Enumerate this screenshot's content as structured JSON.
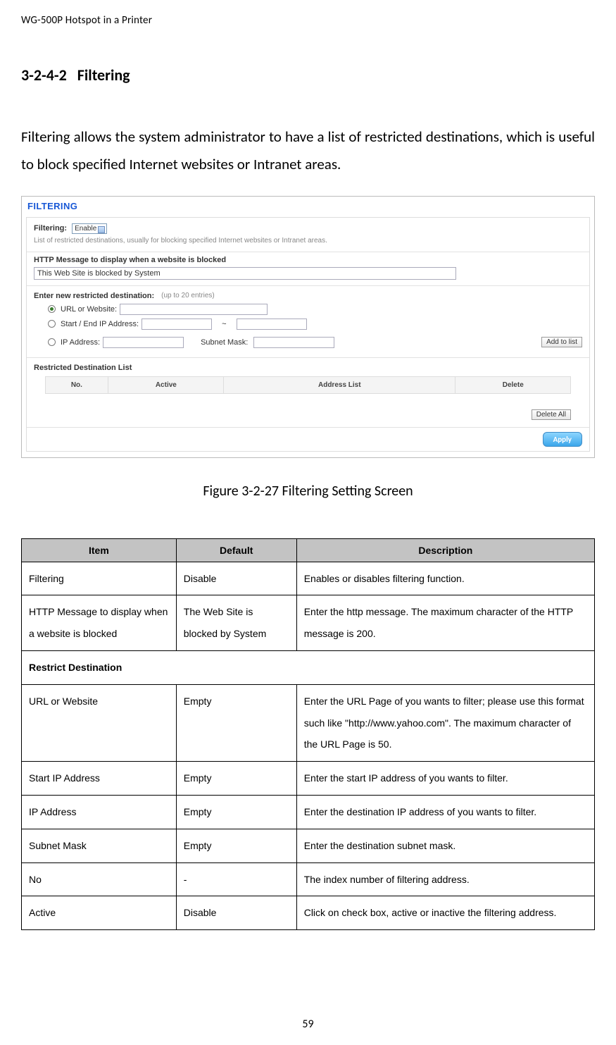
{
  "page_header": "WG-500P Hotspot in a Printer",
  "section": {
    "num": "3-2-4-2",
    "title": "Filtering"
  },
  "intro": "Filtering allows the system administrator to have a list of restricted destinations, which is useful to block specified Internet websites or Intranet areas.",
  "figure": {
    "header": "FILTERING",
    "filtering_label": "Filtering:",
    "filtering_value": "Enable",
    "restricted_desc": "List of restricted destinations, usually for blocking specified Internet websites or Intranet areas.",
    "http_msg_title": "HTTP Message to display when a website is blocked",
    "http_msg_value": "This Web Site is blocked by System",
    "new_dest_title": "Enter new restricted destination:",
    "new_dest_hint": "(up to 20 entries)",
    "url_label": "URL or Website:",
    "startend_label": "Start / End IP Address:",
    "tilde": "~",
    "ip_label": "IP Address:",
    "subnet_label": "Subnet Mask:",
    "add_btn": "Add to list",
    "rest_list_title": "Restricted Destination List",
    "cols": {
      "no": "No.",
      "active": "Active",
      "addr": "Address List",
      "del": "Delete"
    },
    "delete_all_btn": "Delete All",
    "apply_btn": "Apply"
  },
  "figure_caption": "Figure 3-2-27 Filtering Setting Screen",
  "table": {
    "headers": {
      "item": "Item",
      "default": "Default",
      "desc": "Description"
    },
    "rows": [
      {
        "item": "Filtering",
        "default": "Disable",
        "desc": "Enables or disables filtering function."
      },
      {
        "item": "HTTP Message to display when a website is blocked",
        "default": "The Web Site is blocked by System",
        "desc": "Enter the http message. The maximum character of the HTTP message is 200."
      }
    ],
    "section_row": "Restrict Destination",
    "rows2": [
      {
        "item": "URL or Website",
        "default": "Empty",
        "desc": "Enter the URL Page of you wants to filter; please use this format such like \"http://www.yahoo.com\". The maximum character of the URL Page is 50."
      },
      {
        "item": "Start IP Address",
        "default": "Empty",
        "desc": "Enter the start IP address of you wants to filter."
      },
      {
        "item": "IP Address",
        "default": "Empty",
        "desc": "Enter the destination IP address of you wants to filter."
      },
      {
        "item": "Subnet Mask",
        "default": "Empty",
        "desc": "Enter the destination subnet mask."
      },
      {
        "item": "No",
        "default": "-",
        "desc": "The index number of filtering address."
      },
      {
        "item": "Active",
        "default": "Disable",
        "desc": "Click on check box, active or inactive the filtering address."
      }
    ]
  },
  "page_number": "59"
}
